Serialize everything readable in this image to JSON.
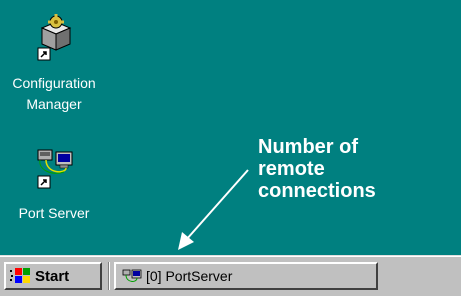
{
  "desktop": {
    "background": "#008080",
    "icons": [
      {
        "label": "Configuration\nManager",
        "icon": "configuration-manager-icon"
      },
      {
        "label": "Port Server",
        "icon": "port-server-icon"
      }
    ]
  },
  "annotation": {
    "text": "Number of\nremote\nconnections",
    "color": "#ffffff"
  },
  "taskbar": {
    "start_label": "Start",
    "task_label": "[0] PortServer",
    "background": "#c0c0c0"
  }
}
